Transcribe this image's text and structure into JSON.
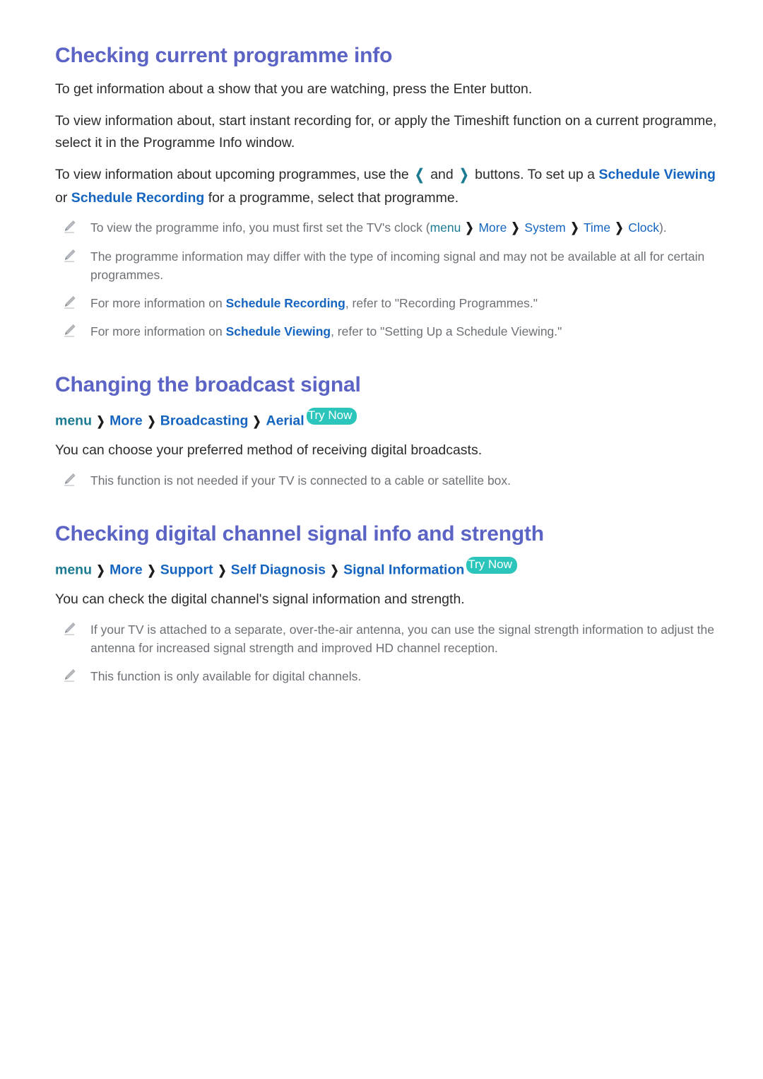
{
  "document": {
    "page_background": "#ffffff",
    "heading_color": "#5b63c4",
    "link_color": "#1565c0",
    "menu_color": "#1c7a91",
    "badge_color": "#2cc5bb",
    "note_text_color": "#6c7076"
  },
  "sections": [
    {
      "id": "checking-current-programme-info",
      "title": "Checking current programme info",
      "paragraphs": [
        "To get information about a show that you are watching, press the Enter button.",
        "To view information about, start instant recording for, or apply the Timeshift function on a current programme, select it in the Programme Info window."
      ],
      "rich_paragraph": {
        "part1": "To view information about upcoming programmes, use the ",
        "left_arrow": "❮",
        "mid": " and ",
        "right_arrow": "❯",
        "part2": " buttons. To set up a ",
        "link1": "Schedule Viewing",
        "part3": " or ",
        "link2": "Schedule Recording",
        "part4": " for a programme, select that programme."
      },
      "notes": [
        {
          "icon": "pencil-icon",
          "prefix": "To view the programme info, you must first set the TV's clock (",
          "path": [
            "menu",
            "More",
            "System",
            "Time",
            "Clock"
          ],
          "suffix": ")."
        },
        {
          "icon": "pencil-icon",
          "text": "The programme information may differ with the type of incoming signal and may not be available at all for certain programmes."
        },
        {
          "icon": "pencil-icon",
          "prefix": "For more information on ",
          "link": "Schedule Recording",
          "suffix": ", refer to \"Recording Programmes.\""
        },
        {
          "icon": "pencil-icon",
          "prefix": "For more information on ",
          "link": "Schedule Viewing",
          "suffix": ", refer to \"Setting Up a Schedule Viewing.\""
        }
      ]
    },
    {
      "id": "changing-the-broadcast-signal",
      "title": "Changing the broadcast signal",
      "breadcrumb": {
        "menu": "menu",
        "items": [
          "More",
          "Broadcasting",
          "Aerial"
        ],
        "separator": "❯",
        "badge": "Try Now"
      },
      "paragraphs": [
        "You can choose your preferred method of receiving digital broadcasts."
      ],
      "notes": [
        {
          "icon": "pencil-icon",
          "text": "This function is not needed if your TV is connected to a cable or satellite box."
        }
      ]
    },
    {
      "id": "checking-digital-channel-signal-info-and-strength",
      "title": "Checking digital channel signal info and strength",
      "breadcrumb": {
        "menu": "menu",
        "items": [
          "More",
          "Support",
          "Self Diagnosis",
          "Signal Information"
        ],
        "separator": "❯",
        "badge": "Try Now"
      },
      "paragraphs": [
        "You can check the digital channel's signal information and strength."
      ],
      "notes": [
        {
          "icon": "pencil-icon",
          "text": "If your TV is attached to a separate, over-the-air antenna, you can use the signal strength information to adjust the antenna for increased signal strength and improved HD channel reception."
        },
        {
          "icon": "pencil-icon",
          "text": "This function is only available for digital channels."
        }
      ]
    }
  ]
}
